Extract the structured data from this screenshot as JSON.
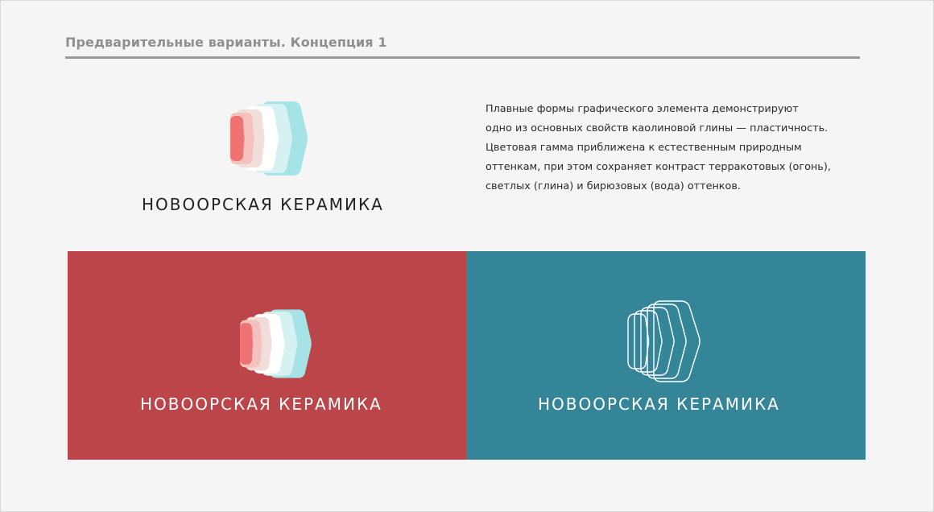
{
  "header": {
    "title": "Предварительные варианты. Концепция 1"
  },
  "brand": {
    "name": "НОВООРСКАЯ КЕРАМИКА"
  },
  "description": {
    "lines": [
      "Плавные формы графического элемента демонстрируют",
      "одно из основных свойств каолиновой глины — пластичность.",
      "Цветовая гамма приближена к естественным природным",
      "оттенкам, при этом сохраняет контраст терракотовых (огонь),",
      "светлых (глина) и бирюзовых (вода) оттенков."
    ]
  },
  "colors": {
    "terracotta_panel": "#bc4549",
    "teal_panel": "#358599",
    "mark_red": "#f07373",
    "mark_teal": "#a6e3e6"
  },
  "panels": [
    {
      "name": "terracotta-panel",
      "variant": "color-logo-white-text"
    },
    {
      "name": "teal-panel",
      "variant": "outline-logo-white-text"
    }
  ]
}
